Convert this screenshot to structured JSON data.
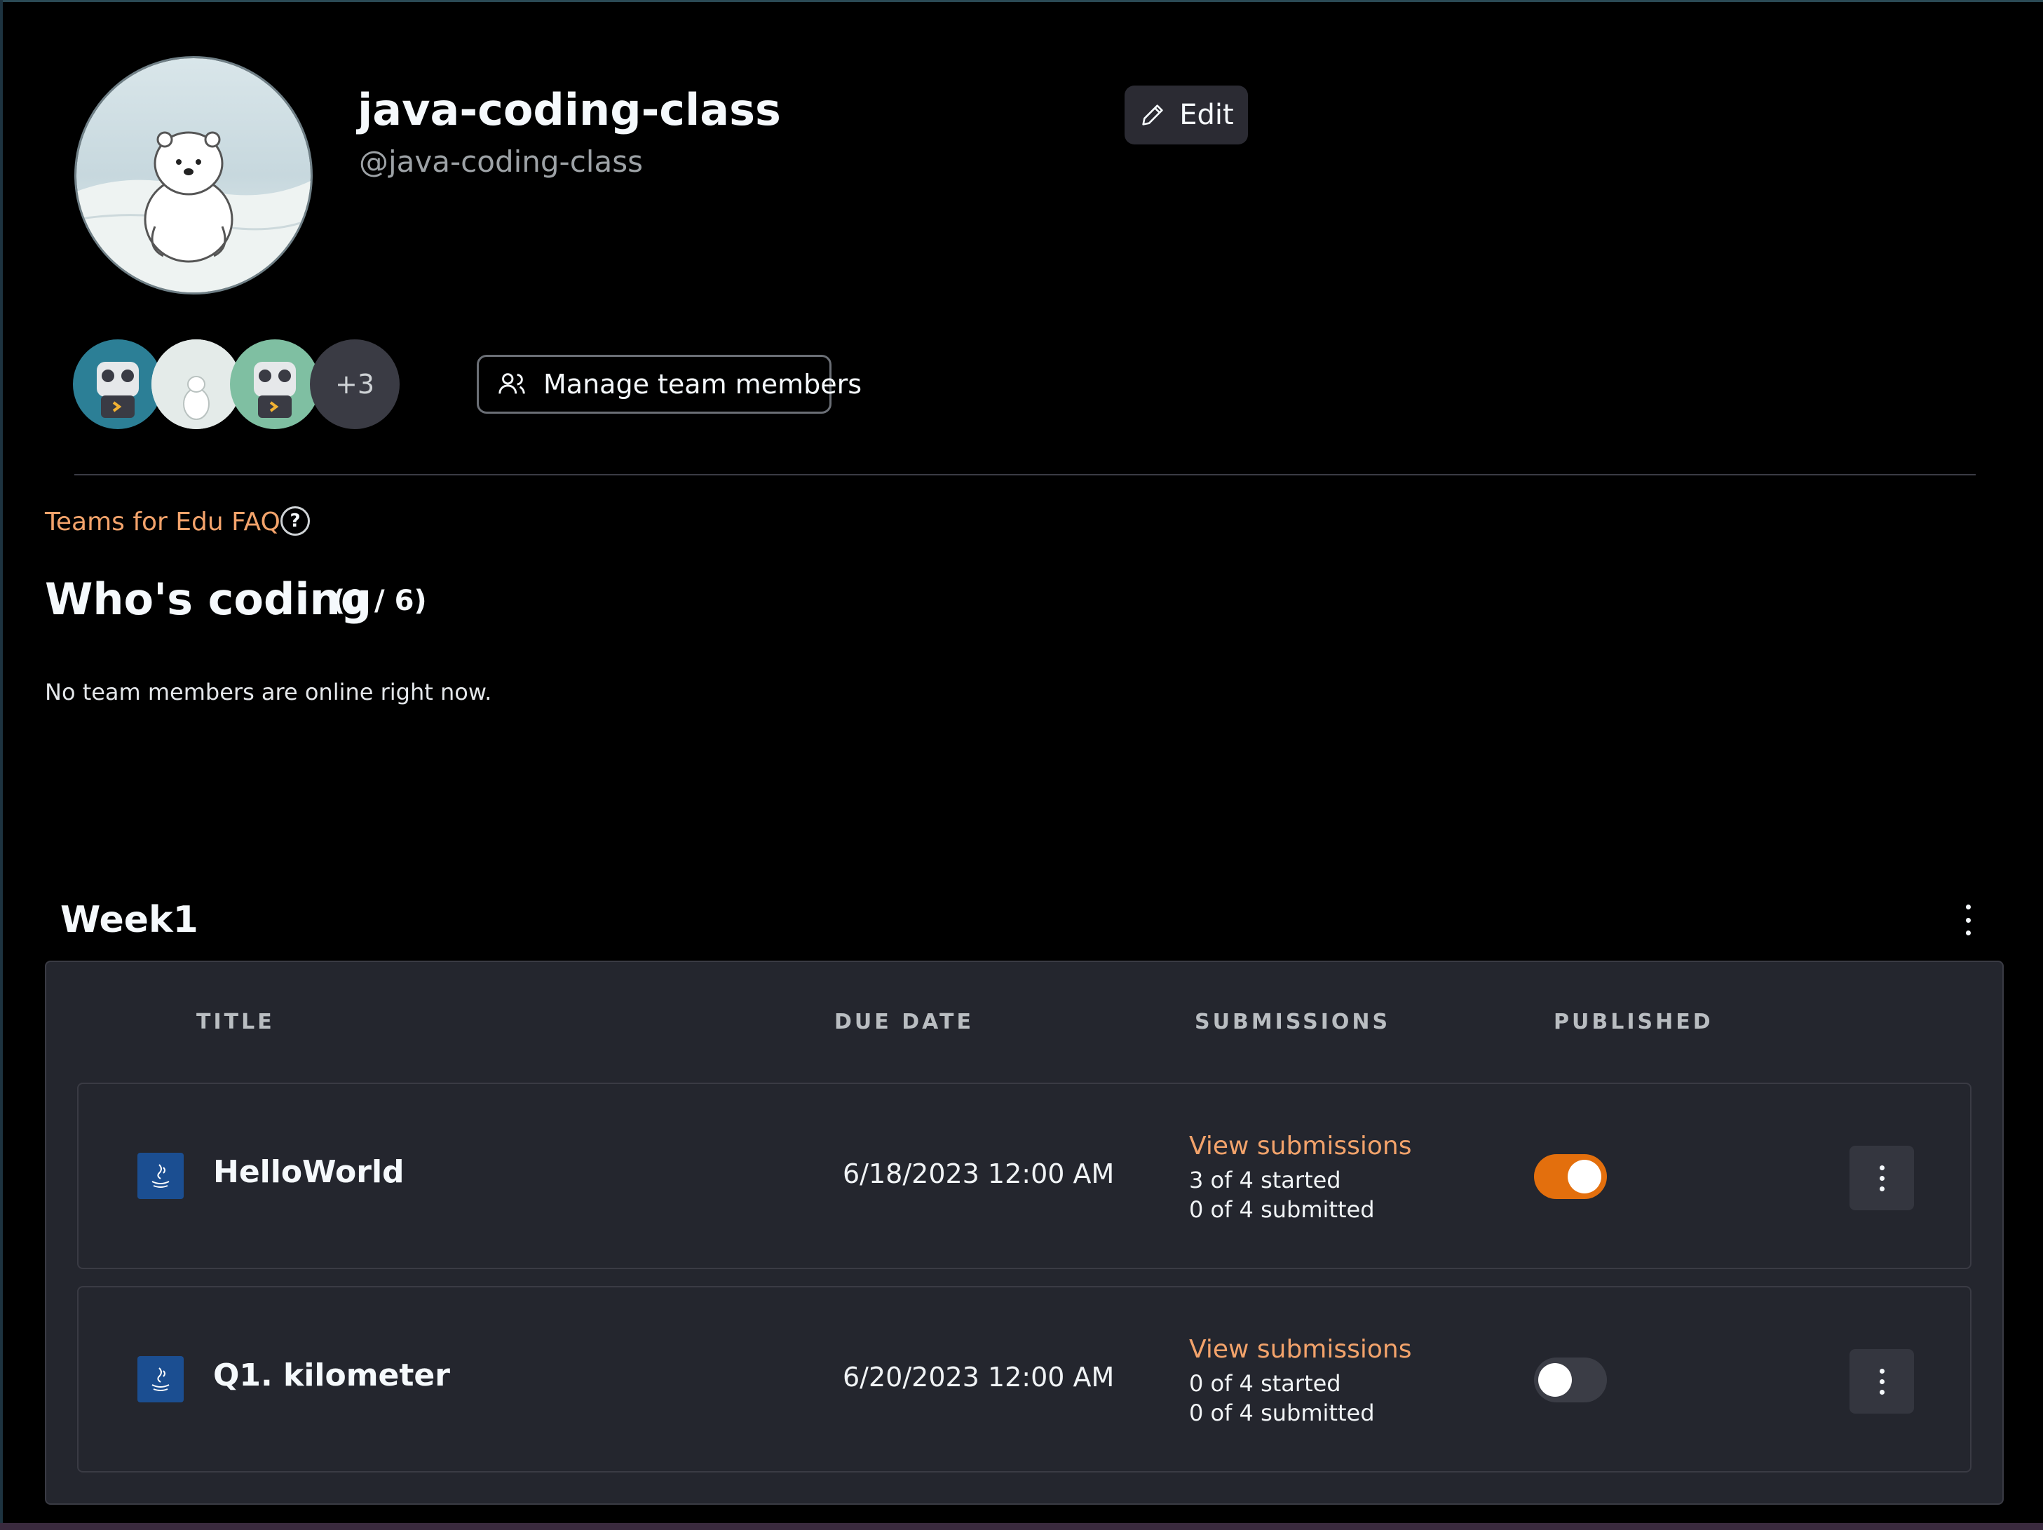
{
  "team": {
    "name": "java-coding-class",
    "handle": "@java-coding-class",
    "avatar_icon": "polar-bear-avatar"
  },
  "edit_button": {
    "label": "Edit",
    "icon": "pencil-icon"
  },
  "members": {
    "avatars": [
      "robot-avatar",
      "polar-bear-avatar",
      "robot-avatar"
    ],
    "more_label": "+3"
  },
  "manage_button": {
    "label": "Manage team members",
    "icon": "users-icon"
  },
  "faq": {
    "label": "Teams for Edu FAQ",
    "help_icon": "?"
  },
  "whos_coding": {
    "title": "Who's coding",
    "count": "(0 / 6)",
    "empty_message": "No team members are online right now."
  },
  "week": {
    "title": "Week1",
    "columns": {
      "title": "TITLE",
      "due_date": "DUE DATE",
      "submissions": "SUBMISSIONS",
      "published": "PUBLISHED"
    },
    "rows": [
      {
        "title": "HelloWorld",
        "due_date": "6/18/2023 12:00 AM",
        "link": "View submissions",
        "started": "3 of 4 started",
        "submitted": "0 of 4 submitted",
        "published": true
      },
      {
        "title": "Q1. kilometer",
        "due_date": "6/20/2023 12:00 AM",
        "link": "View submissions",
        "started": "0 of 4 started",
        "submitted": "0 of 4 submitted",
        "published": false
      }
    ]
  },
  "colors": {
    "accent": "#f3a36b",
    "toggle_on": "#e36f0d",
    "panel": "#24262e"
  }
}
